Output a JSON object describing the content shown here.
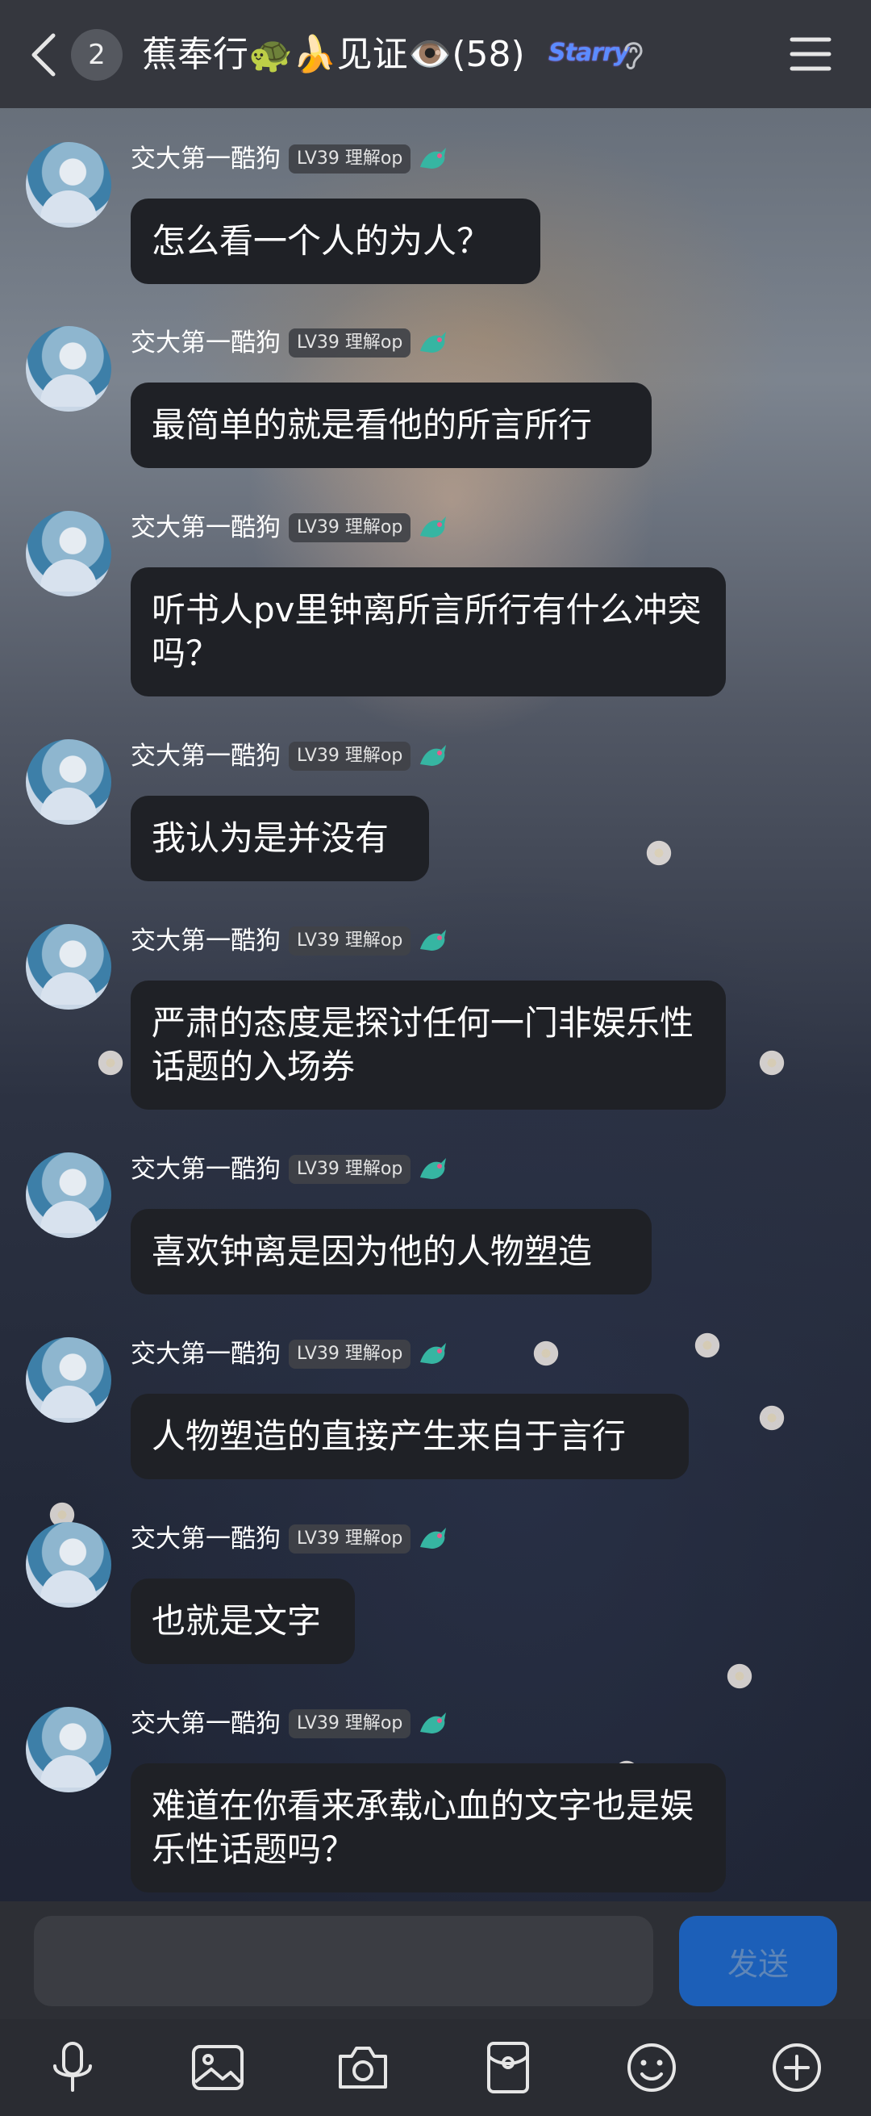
{
  "header": {
    "unread_count": "2",
    "title": "蕉奉行🐢🍌见证👁️(58)",
    "badge_text": "Starry"
  },
  "messages": [
    {
      "sender": "交大第一酷狗",
      "level": "LV39 理解op",
      "text": "怎么看一个人的为人？"
    },
    {
      "sender": "交大第一酷狗",
      "level": "LV39 理解op",
      "text": "最简单的就是看他的所言所行"
    },
    {
      "sender": "交大第一酷狗",
      "level": "LV39 理解op",
      "text": "听书人pv里钟离所言所行有什么冲突吗？"
    },
    {
      "sender": "交大第一酷狗",
      "level": "LV39 理解op",
      "text": "我认为是并没有"
    },
    {
      "sender": "交大第一酷狗",
      "level": "LV39 理解op",
      "text": "严肃的态度是探讨任何一门非娱乐性话题的入场券"
    },
    {
      "sender": "交大第一酷狗",
      "level": "LV39 理解op",
      "text": "喜欢钟离是因为他的人物塑造"
    },
    {
      "sender": "交大第一酷狗",
      "level": "LV39 理解op",
      "text": "人物塑造的直接产生来自于言行"
    },
    {
      "sender": "交大第一酷狗",
      "level": "LV39 理解op",
      "text": "也就是文字"
    },
    {
      "sender": "交大第一酷狗",
      "level": "LV39 理解op",
      "text": "难道在你看来承载心血的文字也是娱乐性话题吗？"
    }
  ],
  "input": {
    "value": "",
    "send_label": "发送"
  },
  "toolbar": {
    "icons": [
      "microphone-icon",
      "image-icon",
      "camera-icon",
      "red-packet-icon",
      "emoji-icon",
      "plus-icon"
    ]
  },
  "colors": {
    "header_bg": "#34363c",
    "bubble_bg": "#1f2126",
    "send_button": "#1c5fb8",
    "badge_bg": "#404248"
  }
}
